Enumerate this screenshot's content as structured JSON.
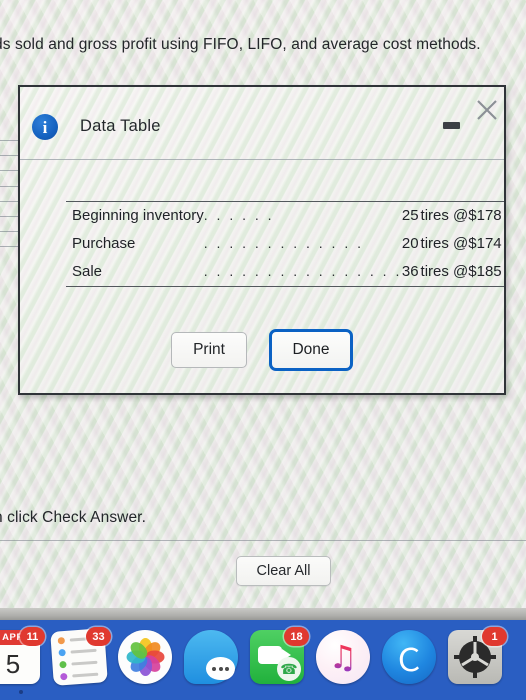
{
  "worksheet": {
    "prompt_line": "ds sold and gross profit using FIFO, LIFO, and average cost methods.",
    "check_answer_line": "n click Check Answer.",
    "clear_all_label": "Clear All"
  },
  "dialog": {
    "title": "Data Table",
    "info_icon": "info-icon",
    "minimize_icon": "minimize-icon",
    "close_icon": "close-icon",
    "table": {
      "rows": [
        {
          "label": "Beginning inventory",
          "dots": ". . . . . .",
          "qty": "25",
          "unit": "tires @",
          "currency": "$",
          "amount": "178"
        },
        {
          "label": "Purchase",
          "dots": ". . . . . . . . . . . . .",
          "qty": "20",
          "unit": "tires @",
          "currency": "$",
          "amount": "174"
        },
        {
          "label": "Sale",
          "dots": ". . . . . . . . . . . . . . . .",
          "qty": "36",
          "unit": "tires @",
          "currency": "$",
          "amount": "185"
        }
      ]
    },
    "buttons": {
      "print_label": "Print",
      "done_label": "Done"
    },
    "accent_focus_color": "#0b62c4"
  },
  "dock": {
    "background_color": "#2a5ec2",
    "items": [
      {
        "name": "calendar",
        "badge": "11",
        "month": "APR",
        "day": "5"
      },
      {
        "name": "reminders",
        "badge": "33"
      },
      {
        "name": "photos",
        "badge": ""
      },
      {
        "name": "messages",
        "badge": ""
      },
      {
        "name": "facetime",
        "badge": "18"
      },
      {
        "name": "music",
        "badge": ""
      },
      {
        "name": "app-store",
        "badge": ""
      },
      {
        "name": "system-preferences",
        "badge": "1"
      }
    ]
  }
}
